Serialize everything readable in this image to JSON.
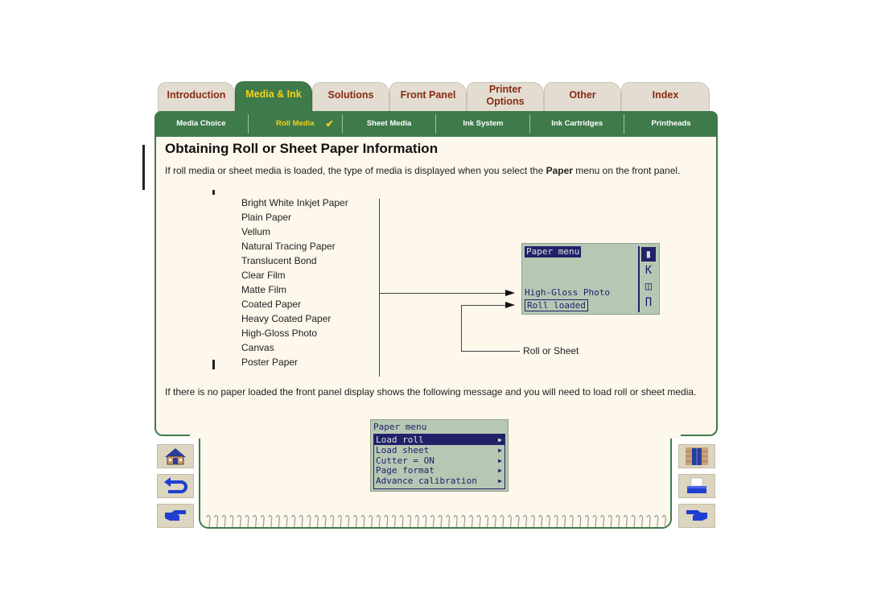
{
  "tabs": [
    {
      "label": "Introduction",
      "active": false
    },
    {
      "label": "Media & Ink",
      "active": true
    },
    {
      "label": "Solutions",
      "active": false
    },
    {
      "label": "Front Panel",
      "active": false
    },
    {
      "label": "Printer Options",
      "active": false
    },
    {
      "label": "Other",
      "active": false
    },
    {
      "label": "Index",
      "active": false
    }
  ],
  "subnav": [
    {
      "label": "Media Choice",
      "active": false
    },
    {
      "label": "Roll Media",
      "active": true,
      "check": "✔"
    },
    {
      "label": "Sheet Media",
      "active": false
    },
    {
      "label": "Ink System",
      "active": false
    },
    {
      "label": "Ink Cartridges",
      "active": false
    },
    {
      "label": "Printheads",
      "active": false
    }
  ],
  "page": {
    "title": "Obtaining Roll or Sheet Paper Information",
    "intro_before": "If roll media or sheet media is loaded, the type of media is displayed when you select the ",
    "intro_bold": "Paper",
    "intro_after": " menu on the front panel.",
    "no_paper_text": "If there is no paper loaded the front panel display shows the following message and you will need to load roll or sheet media.",
    "roll_or_sheet_label": "Roll or Sheet"
  },
  "media_types": [
    "Bright White Inkjet Paper",
    "Plain Paper",
    "Vellum",
    "Natural Tracing Paper",
    "Translucent Bond",
    "Clear Film",
    "Matte Film",
    "Coated Paper",
    "Heavy Coated Paper",
    "High-Gloss Photo",
    "Canvas",
    "Poster Paper"
  ],
  "display1": {
    "header": "Paper menu",
    "media_line": "High-Gloss Photo",
    "status_line": "Roll loaded",
    "icons": [
      "paper-roll-icon",
      "ink-drops-icon",
      "folders-icon",
      "printer-stand-icon"
    ]
  },
  "display2": {
    "header": "Paper menu",
    "items": [
      {
        "label": "Load roll",
        "selected": true
      },
      {
        "label": "Load sheet",
        "selected": false
      },
      {
        "label": "Cutter = ON",
        "selected": false
      },
      {
        "label": "Page format",
        "selected": false
      },
      {
        "label": "Advance calibration",
        "selected": false
      }
    ]
  },
  "nav_buttons": {
    "left": [
      "home-icon",
      "back-icon",
      "next-page-icon"
    ],
    "right": [
      "exit-door-icon",
      "print-icon",
      "previous-page-icon"
    ]
  },
  "colors": {
    "accent_green": "#3f7a4a",
    "active_tab_text": "#f2d21a",
    "inactive_tab_text": "#8a2a12",
    "panel_bg": "#fdf7ec",
    "lcd_bg": "#b6c8b4",
    "lcd_ink": "#23206a"
  }
}
